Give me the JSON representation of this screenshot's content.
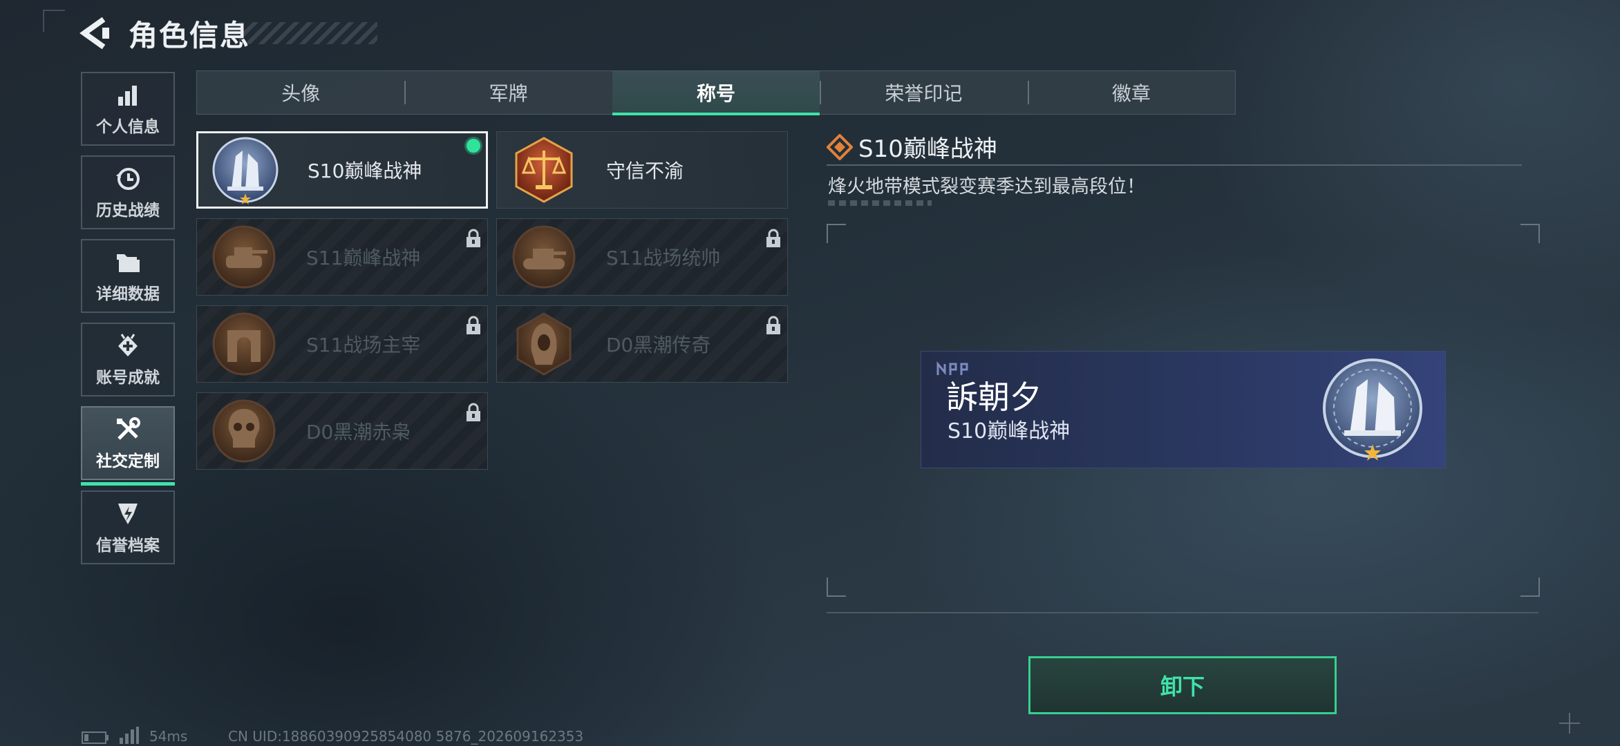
{
  "header": {
    "title": "角色信息"
  },
  "sidebar": {
    "items": [
      {
        "label": "个人信息",
        "icon": "bar-chart-icon"
      },
      {
        "label": "历史战绩",
        "icon": "clock-icon"
      },
      {
        "label": "详细数据",
        "icon": "folder-icon"
      },
      {
        "label": "账号成就",
        "icon": "achievement-icon"
      },
      {
        "label": "社交定制",
        "icon": "tools-icon",
        "active": true
      },
      {
        "label": "信誉档案",
        "icon": "credit-shield-icon"
      }
    ]
  },
  "tabs": [
    {
      "label": "头像"
    },
    {
      "label": "军牌"
    },
    {
      "label": "称号",
      "active": true
    },
    {
      "label": "荣誉印记"
    },
    {
      "label": "徽章"
    }
  ],
  "titles": [
    {
      "name": "S10巅峰战神",
      "locked": false,
      "selected": true,
      "equipped": true,
      "medal": "blue-tower-medal"
    },
    {
      "name": "守信不渝",
      "locked": false,
      "selected": false,
      "medal": "scales-medal"
    },
    {
      "name": "S11巅峰战神",
      "locked": true,
      "medal": "tank-medal"
    },
    {
      "name": "S11战场统帅",
      "locked": true,
      "medal": "tank-medal"
    },
    {
      "name": "S11战场主宰",
      "locked": true,
      "medal": "arch-medal"
    },
    {
      "name": "D0黑潮传奇",
      "locked": true,
      "medal": "hooded-medal"
    },
    {
      "name": "D0黑潮赤枭",
      "locked": true,
      "medal": "skull-medal"
    }
  ],
  "detail": {
    "title": "S10巅峰战神",
    "description": "烽火地带模式裂变赛季达到最高段位！"
  },
  "preview": {
    "player_name": "訴朝夕",
    "title": "S10巅峰战神"
  },
  "action": {
    "unequip_label": "卸下"
  },
  "status_bar": {
    "ping": "54ms",
    "uid": "CN UID:18860390925854080 5876_202609162353"
  },
  "colors": {
    "accent": "#3fe3a8",
    "equipped": "#2fe39b"
  }
}
